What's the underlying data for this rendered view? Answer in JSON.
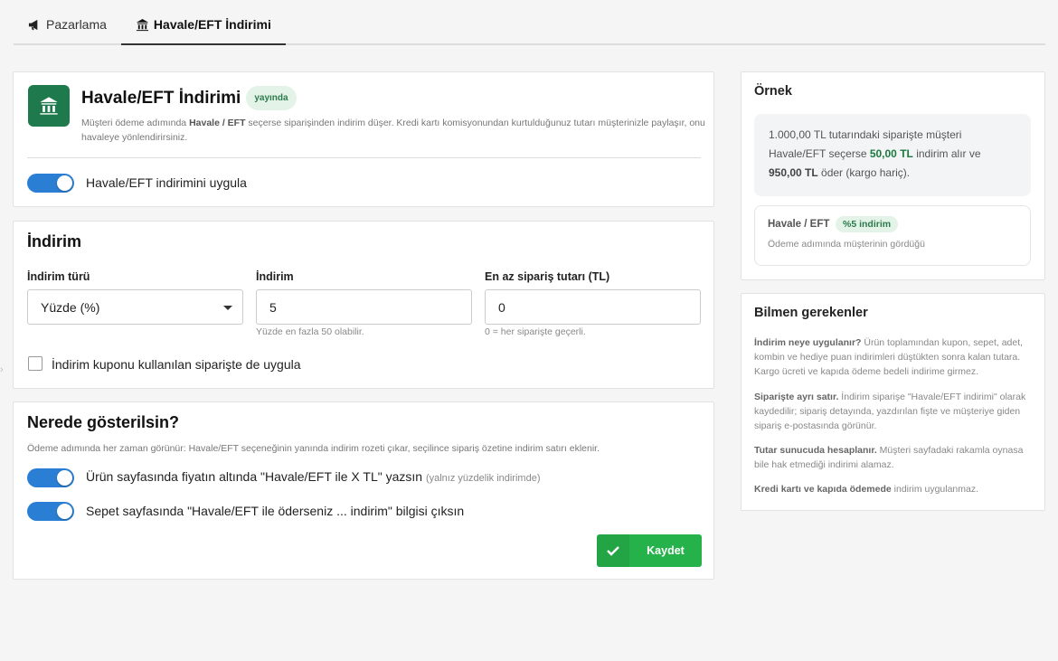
{
  "tabs": [
    {
      "label": "Pazarlama",
      "icon": "megaphone-icon",
      "active": false
    },
    {
      "label": "Havale/EFT İndirimi",
      "icon": "bank-icon",
      "active": true
    }
  ],
  "header": {
    "title": "Havale/EFT İndirimi",
    "status_badge": "yayında",
    "desc_pre": "Müşteri ödeme adımında ",
    "desc_bold": "Havale / EFT",
    "desc_post": " seçerse siparişinden indirim düşer. Kredi kartı komisyonundan kurtulduğunuz tutarı müşterinizle paylaşır, onu havaleye yönlendirirsiniz.",
    "toggle_label": "Havale/EFT indirimini uygula",
    "toggle_on": true
  },
  "discount": {
    "title": "İndirim",
    "type_label": "İndirim türü",
    "type_value": "Yüzde (%)",
    "amount_label": "İndirim",
    "amount_value": "5",
    "amount_hint": "Yüzde en fazla 50 olabilir.",
    "min_label": "En az sipariş tutarı (TL)",
    "min_value": "0",
    "min_hint": "0 = her siparişte geçerli.",
    "coupon_label": "İndirim kuponu kullanılan siparişte de uygula",
    "coupon_checked": false
  },
  "where": {
    "title": "Nerede gösterilsin?",
    "desc": "Ödeme adımında her zaman görünür: Havale/EFT seçeneğinin yanında indirim rozeti çıkar, seçilince sipariş özetine indirim satırı eklenir.",
    "opt1_label": "Ürün sayfasında fiyatın altında \"Havale/EFT ile X TL\" yazsın",
    "opt1_note": "(yalnız yüzdelik indirimde)",
    "opt2_label": "Sepet sayfasında \"Havale/EFT ile öderseniz ... indirim\" bilgisi çıksın",
    "save_label": "Kaydet"
  },
  "example": {
    "title": "Örnek",
    "line1": "1.000,00 TL tutarındaki siparişte müşteri",
    "line2_pre": "Havale/EFT seçerse ",
    "line2_bold": "50,00 TL",
    "line2_post": " indirim alır ve",
    "line3_bold": "950,00 TL",
    "line3_post": " öder (kargo hariç).",
    "pill_name": "Havale / EFT",
    "pill_badge": "%5 indirim",
    "pill_sub": "Ödeme adımında müşterinin gördüğü"
  },
  "know": {
    "title": "Bilmen gerekenler",
    "items": [
      {
        "bold": "İndirim neye uygulanır?",
        "text": " Ürün toplamından kupon, sepet, adet, kombin ve hediye puan indirimleri düştükten sonra kalan tutara. Kargo ücreti ve kapıda ödeme bedeli indirime girmez."
      },
      {
        "bold": "Siparişte ayrı satır.",
        "text": " İndirim siparişe \"Havale/EFT indirimi\" olarak kaydedilir; sipariş detayında, yazdırılan fişte ve müşteriye giden sipariş e-postasında görünür."
      },
      {
        "bold": "Tutar sunucuda hesaplanır.",
        "text": " Müşteri sayfadaki rakamla oynasa bile hak etmediği indirimi alamaz."
      },
      {
        "bold": "Kredi kartı ve kapıda ödemede",
        "text": " indirim uygulanmaz."
      }
    ]
  },
  "colors": {
    "accent": "#2a7fd4",
    "brand_green": "#1e7a4c",
    "save_green": "#26b24b"
  }
}
